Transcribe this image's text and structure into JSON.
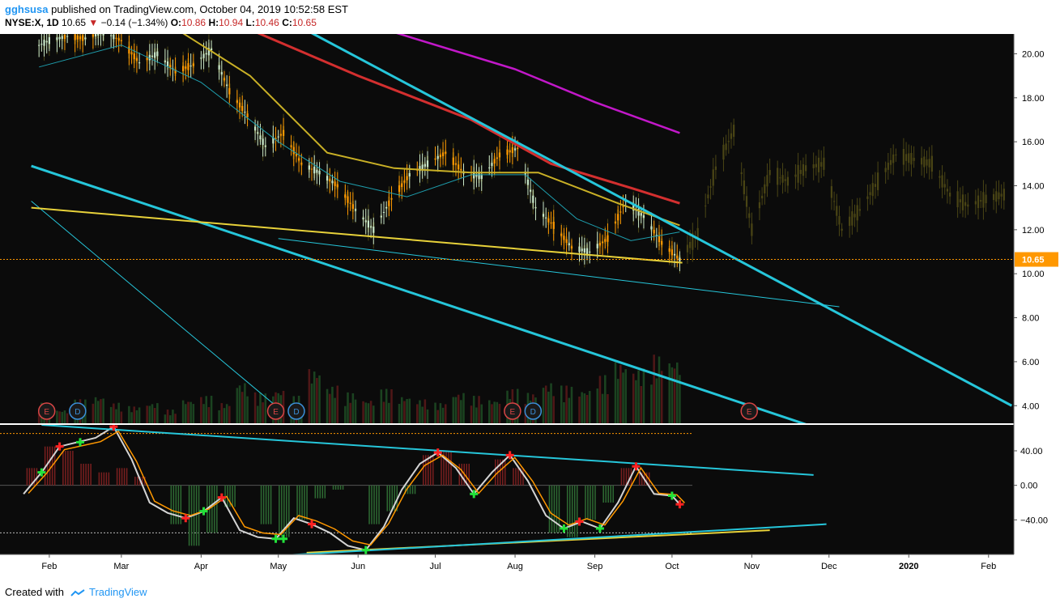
{
  "header": {
    "user": "gghsusa",
    "published": "published on TradingView.com, October 04, 2019 10:52:58 EST",
    "symbol": "NYSE:X, 1D",
    "last": "10.65",
    "change": "−0.14 (−1.34%)",
    "o_label": "O:",
    "o_value": "10.86",
    "h_label": "H:",
    "h_value": "10.94",
    "l_label": "L:",
    "l_value": "10.46",
    "c_label": "C:",
    "c_value": "10.65"
  },
  "footer": {
    "created": "Created with",
    "brand": "TradingView"
  },
  "colors": {
    "background": "#0b0b0b",
    "up": "#c8e6c9",
    "down": "#ff9800",
    "cyan_trend": "#26c6da",
    "yellow_trend": "#e8d23a",
    "ma_red": "#d32f2f",
    "ma_magenta": "#c218c9",
    "ma_yellow": "#c9b026",
    "ma_cyan": "#1e9ead",
    "ghost": "#4a4515",
    "price_line": "#ff9800"
  },
  "chart_data": {
    "type": "candlestick",
    "x_tick_labels": [
      "Feb",
      "Mar",
      "Apr",
      "May",
      "Jun",
      "Jul",
      "Aug",
      "Sep",
      "Oct",
      "Nov",
      "Dec",
      "2020",
      "Feb"
    ],
    "y_tick_labels": [
      "20.00",
      "18.00",
      "16.00",
      "14.00",
      "12.00",
      "10.00",
      "8.00",
      "6.00",
      "4.00"
    ],
    "ylim": [
      3.2,
      20.9
    ],
    "last_price_label": "10.65",
    "event_markers": [
      {
        "label": "E",
        "kind": "earnings"
      },
      {
        "label": "D",
        "kind": "dividend"
      },
      {
        "label": "E",
        "kind": "earnings"
      },
      {
        "label": "D",
        "kind": "dividend"
      },
      {
        "label": "E",
        "kind": "earnings"
      },
      {
        "label": "D",
        "kind": "dividend"
      },
      {
        "label": "E",
        "kind": "earnings"
      }
    ],
    "price_series": [
      {
        "date": "2019-01-28",
        "close": 20.4
      },
      {
        "date": "2019-02-01",
        "close": 20.6
      },
      {
        "date": "2019-02-08",
        "close": 20.8
      },
      {
        "date": "2019-02-15",
        "close": 20.7
      },
      {
        "date": "2019-02-22",
        "close": 21.0
      },
      {
        "date": "2019-03-01",
        "close": 20.6
      },
      {
        "date": "2019-03-08",
        "close": 19.6
      },
      {
        "date": "2019-03-15",
        "close": 20.0
      },
      {
        "date": "2019-03-22",
        "close": 19.2
      },
      {
        "date": "2019-03-29",
        "close": 19.5
      },
      {
        "date": "2019-04-05",
        "close": 20.2
      },
      {
        "date": "2019-04-12",
        "close": 18.3
      },
      {
        "date": "2019-04-19",
        "close": 17.2
      },
      {
        "date": "2019-04-26",
        "close": 15.8
      },
      {
        "date": "2019-05-03",
        "close": 16.4
      },
      {
        "date": "2019-05-10",
        "close": 15.0
      },
      {
        "date": "2019-05-17",
        "close": 14.6
      },
      {
        "date": "2019-05-24",
        "close": 14.0
      },
      {
        "date": "2019-05-31",
        "close": 12.9
      },
      {
        "date": "2019-06-07",
        "close": 12.0
      },
      {
        "date": "2019-06-14",
        "close": 13.4
      },
      {
        "date": "2019-06-21",
        "close": 14.5
      },
      {
        "date": "2019-06-28",
        "close": 15.0
      },
      {
        "date": "2019-07-05",
        "close": 15.5
      },
      {
        "date": "2019-07-12",
        "close": 14.6
      },
      {
        "date": "2019-07-19",
        "close": 14.4
      },
      {
        "date": "2019-07-26",
        "close": 15.4
      },
      {
        "date": "2019-08-02",
        "close": 15.7
      },
      {
        "date": "2019-08-09",
        "close": 13.0
      },
      {
        "date": "2019-08-16",
        "close": 12.2
      },
      {
        "date": "2019-08-23",
        "close": 11.2
      },
      {
        "date": "2019-08-30",
        "close": 11.0
      },
      {
        "date": "2019-09-06",
        "close": 11.6
      },
      {
        "date": "2019-09-13",
        "close": 13.3
      },
      {
        "date": "2019-09-20",
        "close": 12.6
      },
      {
        "date": "2019-09-27",
        "close": 11.4
      },
      {
        "date": "2019-10-04",
        "close": 10.65
      }
    ],
    "ghost_series": [
      {
        "date": "2019-10-11",
        "close": 11.8
      },
      {
        "date": "2019-10-18",
        "close": 14.8
      },
      {
        "date": "2019-10-25",
        "close": 16.5
      },
      {
        "date": "2019-11-01",
        "close": 12.0
      },
      {
        "date": "2019-11-08",
        "close": 14.6
      },
      {
        "date": "2019-11-15",
        "close": 14.2
      },
      {
        "date": "2019-11-22",
        "close": 14.8
      },
      {
        "date": "2019-11-29",
        "close": 15.0
      },
      {
        "date": "2019-12-06",
        "close": 12.0
      },
      {
        "date": "2019-12-13",
        "close": 12.9
      },
      {
        "date": "2019-12-20",
        "close": 14.2
      },
      {
        "date": "2019-12-27",
        "close": 15.4
      },
      {
        "date": "2020-01-03",
        "close": 15.2
      },
      {
        "date": "2020-01-10",
        "close": 15.0
      },
      {
        "date": "2020-01-17",
        "close": 13.6
      },
      {
        "date": "2020-01-24",
        "close": 13.1
      },
      {
        "date": "2020-01-31",
        "close": 13.4
      },
      {
        "date": "2020-02-07",
        "close": 13.6
      }
    ],
    "moving_averages": [
      {
        "color": "magenta",
        "points": [
          {
            "date": "2019-04-25",
            "value": 22.8
          },
          {
            "date": "2019-08-01",
            "value": 19.3
          },
          {
            "date": "2019-09-01",
            "value": 17.8
          },
          {
            "date": "2019-10-04",
            "value": 16.4
          }
        ]
      },
      {
        "color": "red",
        "points": [
          {
            "date": "2019-04-12",
            "value": 21.5
          },
          {
            "date": "2019-06-01",
            "value": 19.0
          },
          {
            "date": "2019-07-15",
            "value": 17.0
          },
          {
            "date": "2019-08-15",
            "value": 15.0
          },
          {
            "date": "2019-09-15",
            "value": 13.9
          },
          {
            "date": "2019-10-04",
            "value": 13.2
          }
        ]
      },
      {
        "color": "yellow",
        "points": [
          {
            "date": "2019-03-20",
            "value": 21.3
          },
          {
            "date": "2019-04-20",
            "value": 19.0
          },
          {
            "date": "2019-05-20",
            "value": 15.5
          },
          {
            "date": "2019-06-15",
            "value": 14.8
          },
          {
            "date": "2019-07-15",
            "value": 14.6
          },
          {
            "date": "2019-08-10",
            "value": 14.6
          },
          {
            "date": "2019-09-10",
            "value": 13.2
          },
          {
            "date": "2019-10-04",
            "value": 12.2
          }
        ]
      },
      {
        "color": "cyan",
        "points": [
          {
            "date": "2019-01-28",
            "value": 19.4
          },
          {
            "date": "2019-03-01",
            "value": 20.4
          },
          {
            "date": "2019-04-01",
            "value": 18.7
          },
          {
            "date": "2019-05-01",
            "value": 16.0
          },
          {
            "date": "2019-05-25",
            "value": 14.2
          },
          {
            "date": "2019-06-20",
            "value": 13.5
          },
          {
            "date": "2019-07-15",
            "value": 14.5
          },
          {
            "date": "2019-08-05",
            "value": 14.5
          },
          {
            "date": "2019-08-25",
            "value": 12.5
          },
          {
            "date": "2019-09-15",
            "value": 11.5
          },
          {
            "date": "2019-10-04",
            "value": 11.9
          }
        ]
      }
    ],
    "trendlines": [
      {
        "color": "cyan",
        "width": 3,
        "from": {
          "date": "2019-04-27",
          "value": 22.0
        },
        "to": {
          "date": "2020-02-10",
          "value": 4.0
        }
      },
      {
        "color": "cyan",
        "width": 3,
        "from": {
          "date": "2019-01-25",
          "value": 14.9
        },
        "to": {
          "date": "2019-12-01",
          "value": 2.8
        }
      },
      {
        "color": "cyan",
        "width": 1,
        "from": {
          "date": "2019-01-25",
          "value": 13.3
        },
        "to": {
          "date": "2019-05-02",
          "value": 3.8
        }
      },
      {
        "color": "cyan",
        "width": 1,
        "from": {
          "date": "2019-05-01",
          "value": 11.6
        },
        "to": {
          "date": "2019-12-05",
          "value": 8.5
        }
      },
      {
        "color": "yellow",
        "width": 2,
        "from": {
          "date": "2019-01-25",
          "value": 13.0
        },
        "to": {
          "date": "2019-10-05",
          "value": 10.5
        }
      }
    ],
    "volume_relative": [
      0.3,
      0.2,
      0.35,
      0.4,
      0.3,
      0.25,
      0.3,
      0.2,
      0.35,
      0.4,
      0.3,
      0.6,
      0.45,
      0.5,
      0.4,
      0.8,
      0.55,
      0.45,
      0.35,
      0.5,
      0.4,
      0.35,
      0.3,
      0.45,
      0.4,
      0.35,
      0.5,
      0.45,
      0.6,
      0.55,
      0.5,
      0.7,
      0.9,
      0.8,
      1.0,
      0.95,
      0.4
    ],
    "oscillator": {
      "y_tick_labels": [
        "40.00",
        "0.00",
        "−40.00"
      ],
      "ylim": [
        -80,
        70
      ],
      "upper_level": 60,
      "lower_level": -55,
      "k_line": [
        {
          "date": "2019-01-22",
          "value": -10
        },
        {
          "date": "2019-01-29",
          "value": 15
        },
        {
          "date": "2019-02-05",
          "value": 45
        },
        {
          "date": "2019-02-12",
          "value": 50
        },
        {
          "date": "2019-02-19",
          "value": 55
        },
        {
          "date": "2019-02-26",
          "value": 68
        },
        {
          "date": "2019-03-05",
          "value": 30
        },
        {
          "date": "2019-03-12",
          "value": -20
        },
        {
          "date": "2019-03-19",
          "value": -32
        },
        {
          "date": "2019-03-26",
          "value": -38
        },
        {
          "date": "2019-04-02",
          "value": -30
        },
        {
          "date": "2019-04-09",
          "value": -14
        },
        {
          "date": "2019-04-16",
          "value": -52
        },
        {
          "date": "2019-04-23",
          "value": -60
        },
        {
          "date": "2019-04-30",
          "value": -62
        },
        {
          "date": "2019-05-07",
          "value": -38
        },
        {
          "date": "2019-05-14",
          "value": -45
        },
        {
          "date": "2019-05-21",
          "value": -55
        },
        {
          "date": "2019-05-28",
          "value": -70
        },
        {
          "date": "2019-06-04",
          "value": -75
        },
        {
          "date": "2019-06-11",
          "value": -48
        },
        {
          "date": "2019-06-18",
          "value": -5
        },
        {
          "date": "2019-06-25",
          "value": 25
        },
        {
          "date": "2019-07-02",
          "value": 38
        },
        {
          "date": "2019-07-09",
          "value": 20
        },
        {
          "date": "2019-07-16",
          "value": -10
        },
        {
          "date": "2019-07-23",
          "value": 15
        },
        {
          "date": "2019-07-30",
          "value": 35
        },
        {
          "date": "2019-08-06",
          "value": 5
        },
        {
          "date": "2019-08-13",
          "value": -35
        },
        {
          "date": "2019-08-20",
          "value": -50
        },
        {
          "date": "2019-08-27",
          "value": -42
        },
        {
          "date": "2019-09-03",
          "value": -50
        },
        {
          "date": "2019-09-10",
          "value": -20
        },
        {
          "date": "2019-09-17",
          "value": 22
        },
        {
          "date": "2019-09-24",
          "value": -10
        },
        {
          "date": "2019-10-01",
          "value": -12
        },
        {
          "date": "2019-10-04",
          "value": -22
        }
      ],
      "histogram": [
        {
          "date": "2019-01-25",
          "value": 20
        },
        {
          "date": "2019-02-01",
          "value": 45
        },
        {
          "date": "2019-02-08",
          "value": 40
        },
        {
          "date": "2019-02-15",
          "value": 25
        },
        {
          "date": "2019-02-22",
          "value": 15
        },
        {
          "date": "2019-03-01",
          "value": 20
        },
        {
          "date": "2019-03-08",
          "value": 10
        },
        {
          "date": "2019-03-22",
          "value": -45
        },
        {
          "date": "2019-03-29",
          "value": -70
        },
        {
          "date": "2019-04-05",
          "value": -55
        },
        {
          "date": "2019-04-12",
          "value": -25
        },
        {
          "date": "2019-04-26",
          "value": -45
        },
        {
          "date": "2019-05-03",
          "value": -60
        },
        {
          "date": "2019-05-10",
          "value": -40
        },
        {
          "date": "2019-05-17",
          "value": -15
        },
        {
          "date": "2019-05-24",
          "value": -5
        },
        {
          "date": "2019-06-07",
          "value": -45
        },
        {
          "date": "2019-06-14",
          "value": -30
        },
        {
          "date": "2019-06-21",
          "value": -10
        },
        {
          "date": "2019-06-28",
          "value": 35
        },
        {
          "date": "2019-07-05",
          "value": 40
        },
        {
          "date": "2019-07-12",
          "value": 25
        },
        {
          "date": "2019-07-26",
          "value": 30
        },
        {
          "date": "2019-08-02",
          "value": 20
        },
        {
          "date": "2019-08-16",
          "value": -55
        },
        {
          "date": "2019-08-23",
          "value": -60
        },
        {
          "date": "2019-08-30",
          "value": -40
        },
        {
          "date": "2019-09-06",
          "value": -20
        },
        {
          "date": "2019-09-13",
          "value": 20
        },
        {
          "date": "2019-09-20",
          "value": 15
        }
      ],
      "markers": [
        {
          "date": "2019-01-29",
          "kind": "buy"
        },
        {
          "date": "2019-02-05",
          "kind": "sell"
        },
        {
          "date": "2019-02-13",
          "kind": "buy"
        },
        {
          "date": "2019-02-26",
          "kind": "sell"
        },
        {
          "date": "2019-03-26",
          "kind": "sell"
        },
        {
          "date": "2019-04-02",
          "kind": "buy"
        },
        {
          "date": "2019-04-09",
          "kind": "sell"
        },
        {
          "date": "2019-04-30",
          "kind": "buy"
        },
        {
          "date": "2019-05-03",
          "kind": "buy"
        },
        {
          "date": "2019-05-14",
          "kind": "sell"
        },
        {
          "date": "2019-06-04",
          "kind": "buy"
        },
        {
          "date": "2019-07-02",
          "kind": "sell"
        },
        {
          "date": "2019-07-16",
          "kind": "buy"
        },
        {
          "date": "2019-07-30",
          "kind": "sell"
        },
        {
          "date": "2019-08-20",
          "kind": "buy"
        },
        {
          "date": "2019-08-26",
          "kind": "sell"
        },
        {
          "date": "2019-09-03",
          "kind": "buy"
        },
        {
          "date": "2019-09-17",
          "kind": "sell"
        },
        {
          "date": "2019-10-01",
          "kind": "buy"
        },
        {
          "date": "2019-10-04",
          "kind": "sell"
        }
      ],
      "trendlines": [
        {
          "color": "cyan",
          "from": {
            "date": "2019-01-29",
            "value": 70
          },
          "to": {
            "date": "2019-11-25",
            "value": 12
          }
        },
        {
          "color": "yellow",
          "from": {
            "date": "2019-05-12",
            "value": -78
          },
          "to": {
            "date": "2019-11-08",
            "value": -52
          }
        },
        {
          "color": "cyan",
          "from": {
            "date": "2019-04-10",
            "value": -85
          },
          "to": {
            "date": "2019-11-30",
            "value": -45
          }
        }
      ]
    }
  }
}
